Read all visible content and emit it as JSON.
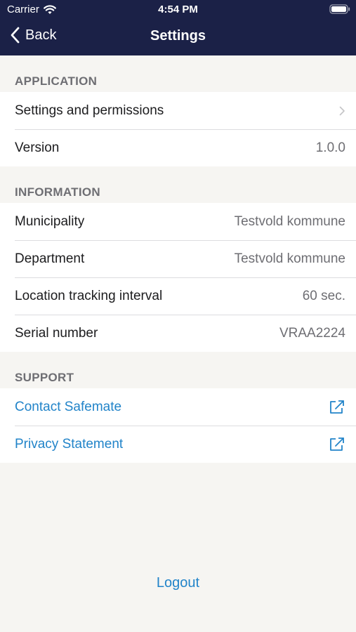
{
  "status_bar": {
    "carrier": "Carrier",
    "time": "4:54 PM"
  },
  "nav": {
    "back_label": "Back",
    "title": "Settings"
  },
  "sections": {
    "application": {
      "header": "APPLICATION",
      "settings_label": "Settings and permissions",
      "version_label": "Version",
      "version_value": "1.0.0"
    },
    "information": {
      "header": "INFORMATION",
      "municipality_label": "Municipality",
      "municipality_value": "Testvold kommune",
      "department_label": "Department",
      "department_value": "Testvold kommune",
      "interval_label": "Location tracking interval",
      "interval_value": "60 sec.",
      "serial_label": "Serial number",
      "serial_value": "VRAA2224"
    },
    "support": {
      "header": "SUPPORT",
      "contact_label": "Contact Safemate",
      "privacy_label": "Privacy Statement"
    }
  },
  "logout_label": "Logout",
  "colors": {
    "nav_background": "#1b2147",
    "link": "#2284c9",
    "page_background": "#f6f5f2"
  },
  "icons": [
    "wifi-icon",
    "battery-icon",
    "back-chevron-icon",
    "chevron-right-icon",
    "external-link-icon"
  ]
}
